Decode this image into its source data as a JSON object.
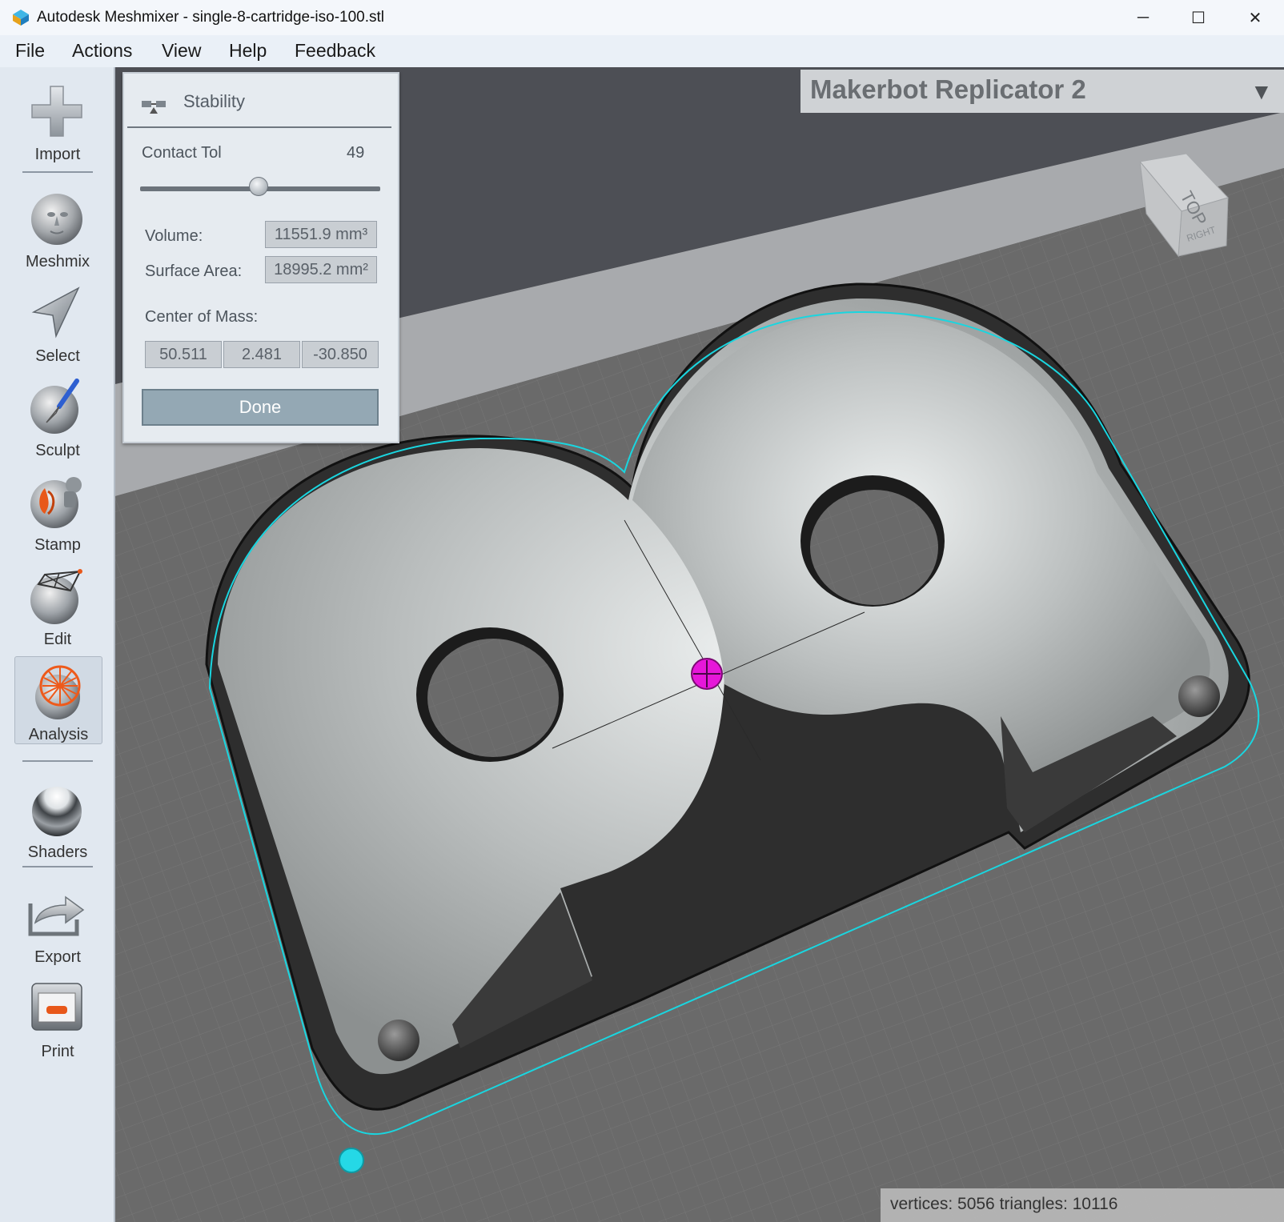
{
  "window": {
    "title": "Autodesk Meshmixer - single-8-cartridge-iso-100.stl",
    "minimize": "─",
    "maximize": "☐",
    "close": "✕"
  },
  "menu": [
    "File",
    "Actions",
    "View",
    "Help",
    "Feedback"
  ],
  "tools": {
    "import": "Import",
    "meshmix": "Meshmix",
    "select": "Select",
    "sculpt": "Sculpt",
    "stamp": "Stamp",
    "edit": "Edit",
    "analysis": "Analysis",
    "shaders": "Shaders",
    "export": "Export",
    "print": "Print"
  },
  "active_tool": "Analysis",
  "stability": {
    "title": "Stability",
    "contact_tol_label": "Contact Tol",
    "contact_tol_value": "49",
    "contact_tol_fraction": 0.49,
    "volume_label": "Volume:",
    "volume_value": "11551.9 mm³",
    "surface_area_label": "Surface Area:",
    "surface_area_value": "18995.2 mm²",
    "center_of_mass_label": "Center of Mass:",
    "com_x": "50.511",
    "com_y": "2.481",
    "com_z": "-30.850",
    "done_label": "Done"
  },
  "printer": {
    "name": "Makerbot Replicator 2",
    "dropdown_icon": "triangle-down-icon"
  },
  "view_cube": {
    "top": "TOP",
    "right": "RIGHT"
  },
  "stats": "vertices: 5056 triangles: 10116",
  "colors": {
    "selection_outline": "#19d6e0",
    "center_of_mass_marker": "#e617d9",
    "pivot_marker": "#25d8e6",
    "done_button": "#94a8b4"
  }
}
